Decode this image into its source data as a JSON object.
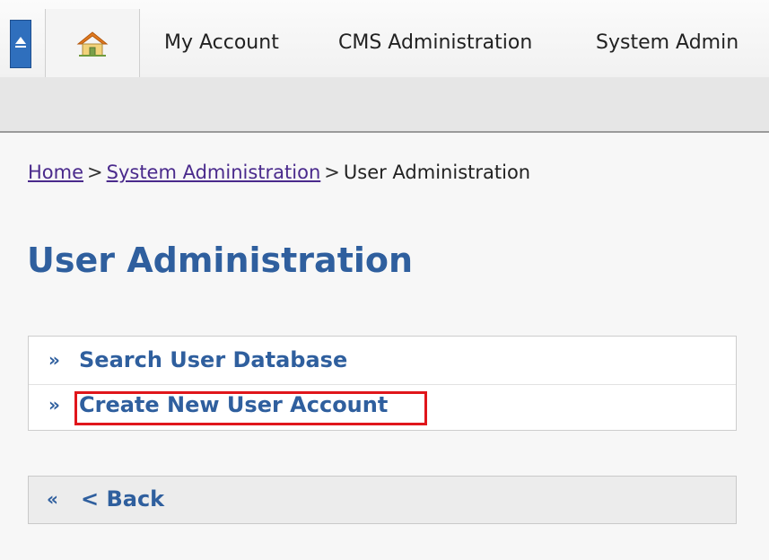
{
  "nav": {
    "items": [
      "My Account",
      "CMS Administration",
      "System Admin"
    ]
  },
  "breadcrumb": {
    "home": "Home",
    "system_admin": "System Administration",
    "current": "User Administration",
    "separator": ">"
  },
  "page": {
    "title": "User Administration"
  },
  "links": [
    {
      "marker": "»",
      "label": "Search User Database"
    },
    {
      "marker": "»",
      "label": "Create New User Account"
    }
  ],
  "back": {
    "marker": "«",
    "label": "< Back"
  },
  "colors": {
    "accent": "#2f5f9e",
    "highlight": "#e0161b",
    "visited_link": "#4a2a8c"
  }
}
